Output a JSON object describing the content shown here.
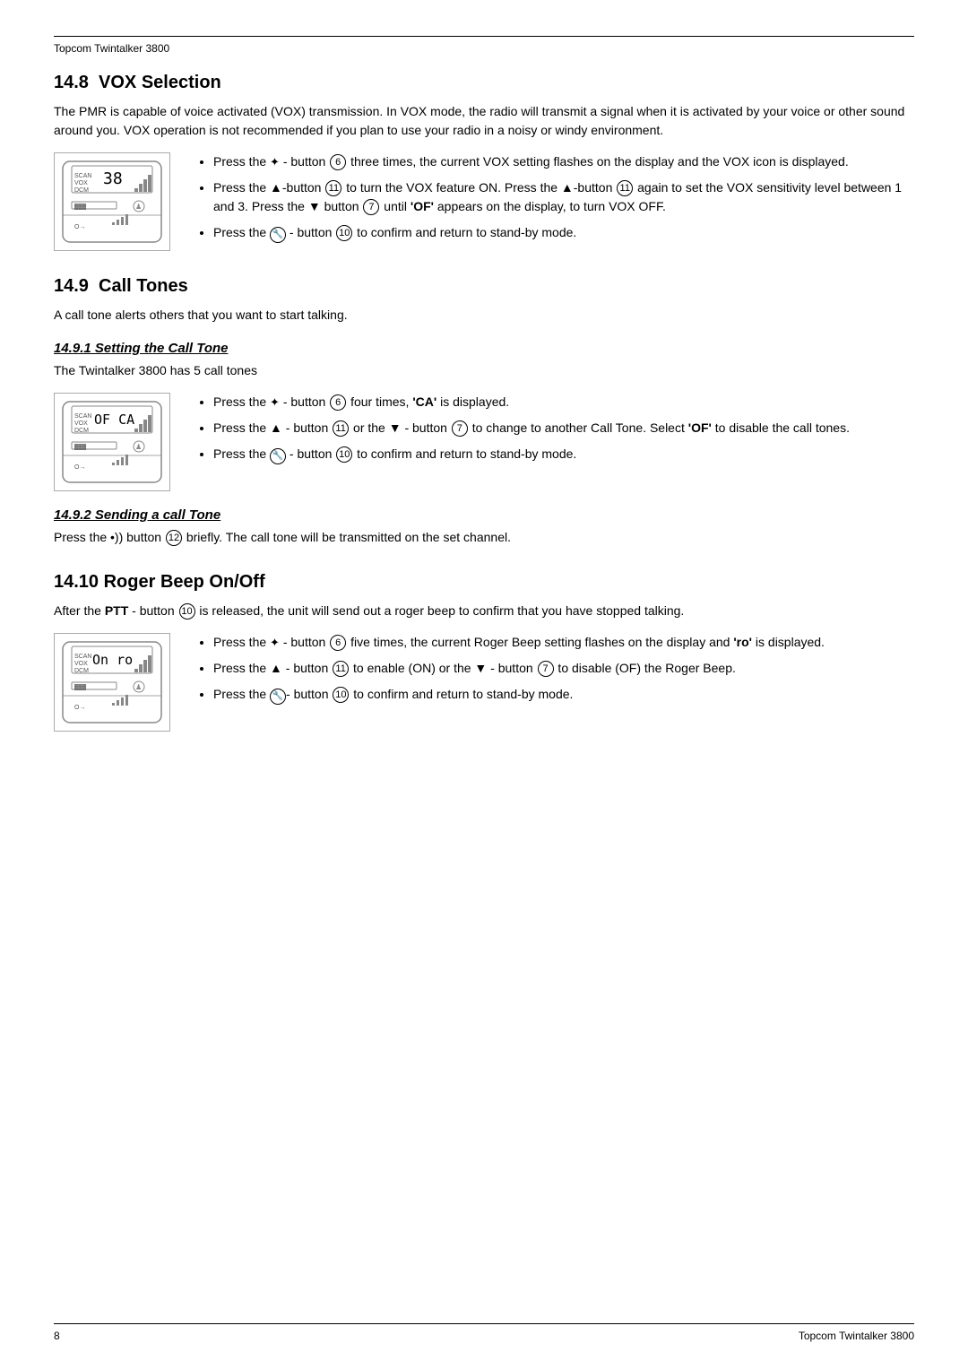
{
  "header": {
    "text": "Topcom Twintalker 3800"
  },
  "footer": {
    "left": "8",
    "right": "Topcom Twintalker 3800"
  },
  "sections": {
    "vox": {
      "title": "14.8  VOX Selection",
      "body": "The PMR is capable of voice activated (VOX) transmission. In VOX mode, the radio will transmit a signal when it is activated by your voice or other sound around you. VOX operation is not recommended if you plan to use your radio in a noisy or windy environment.",
      "bullets": [
        "Press the ✦ - button ⑥ three times, the current VOX setting flashes on the display and the VOX icon is displayed.",
        "Press the ▲-button ⑪ to turn the VOX feature ON. Press the ▲-button ⑪ again to set the VOX sensitivity level between 1 and 3. Press the ▼ button ⑦ until 'OF' appears on the display, to turn VOX OFF.",
        "Press the ⑩ - button ⑩ to confirm and return to stand-by mode."
      ]
    },
    "callTones": {
      "title": "14.9  Call Tones",
      "body": "A call tone alerts others that you want to start talking.",
      "sub1": {
        "title": "14.9.1 Setting the Call Tone",
        "body": "The Twintalker 3800 has 5 call tones",
        "bullets": [
          "Press the ✦ - button ⑥ four times, 'CA' is displayed.",
          "Press the ▲ - button ⑪ or the ▼ - button ⑦ to change to another Call Tone. Select 'OF' to disable the call tones.",
          "Press the ⑩ - button ⑩ to confirm and return to stand-by mode."
        ]
      },
      "sub2": {
        "title": "14.9.2 Sending a call Tone",
        "body": "Press the •)) button ⑫ briefly. The call tone will be transmitted on the set channel."
      }
    },
    "rogerBeep": {
      "title": "14.10  Roger Beep On/Off",
      "body_before": "After the PTT  - button ⑩ is released, the unit  will send out a roger beep to confirm that you have stopped talking.",
      "bullets": [
        "Press the ✦ - button ⑥ five times, the current Roger Beep setting flashes on the display and 'ro' is displayed.",
        "Press the ▲ - button ⑪ to enable (ON) or the ▼ - button ⑦ to disable (OF) the Roger Beep.",
        "Press the ⑩- button ⑩ to confirm and return to stand-by mode."
      ]
    }
  }
}
